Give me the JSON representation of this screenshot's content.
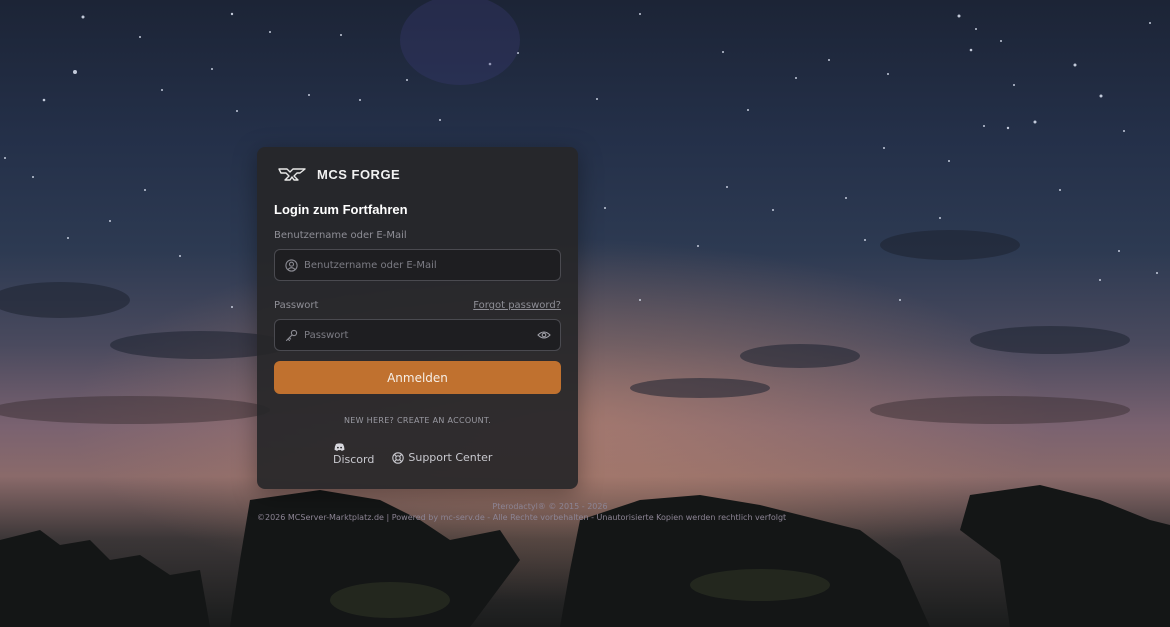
{
  "brand": {
    "name": "MCS FORGE",
    "logo_icon": "forge-logo-icon"
  },
  "login": {
    "title": "Login zum Fortfahren",
    "username": {
      "label": "Benutzername oder E-Mail",
      "placeholder": "Benutzername oder E-Mail",
      "value": "",
      "icon": "user-circle-icon"
    },
    "password": {
      "label": "Passwort",
      "placeholder": "Passwort",
      "value": "",
      "icon": "key-icon",
      "toggle_icon": "eye-icon"
    },
    "forgot_label": "Forgot password?",
    "submit_label": "Anmelden",
    "create_account_label": "NEW HERE? CREATE AN ACCOUNT.",
    "discord_label": "Discord",
    "support_label": "Support Center"
  },
  "footer": {
    "line1": "Pterodactyl® © 2015 - 2026",
    "line2": "©2026 MCServer-Marktplatz.de | Powered by mc-serv.de - Alle Rechte vorbehalten - Unautorisierte Kopien werden rechtlich verfolgt"
  },
  "colors": {
    "accent": "#c0712f",
    "card": "#262628",
    "field_bg": "#1e1e21"
  }
}
